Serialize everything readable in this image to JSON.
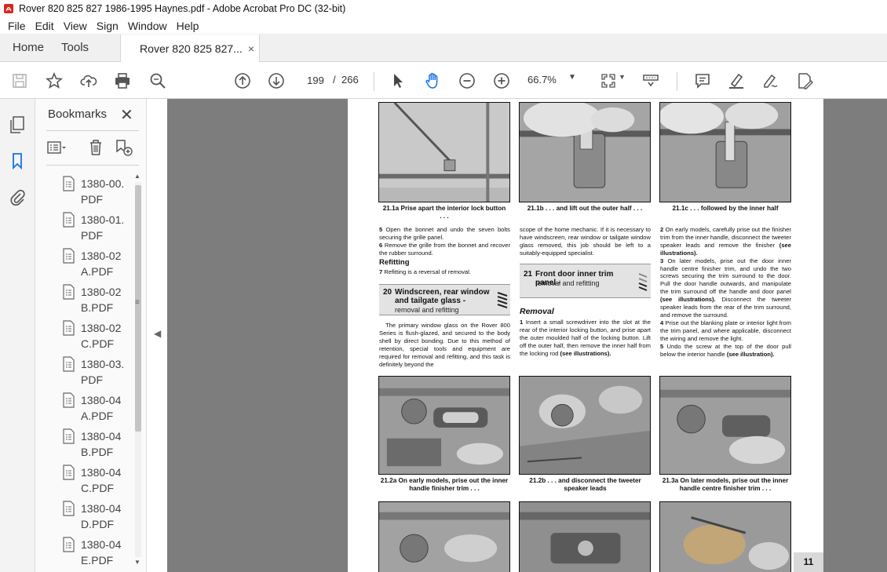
{
  "window": {
    "title": "Rover 820 825 827 1986-1995 Haynes.pdf - Adobe Acrobat Pro DC (32-bit)"
  },
  "menu": [
    "File",
    "Edit",
    "View",
    "Sign",
    "Window",
    "Help"
  ],
  "tabs": {
    "home": "Home",
    "tools": "Tools",
    "document": "Rover 820 825 827...",
    "close": "×"
  },
  "toolbar": {
    "page_current": "199",
    "page_separator": "/",
    "page_total": "266",
    "zoom": "66.7%",
    "icons": [
      "save-icon",
      "star-icon",
      "upload-icon",
      "print-icon",
      "zoom-search-icon",
      "prev-page-icon",
      "next-page-icon",
      "pointer-icon",
      "hand-icon",
      "zoom-out-icon",
      "zoom-in-icon",
      "page-fit-icon",
      "scroll-mode-icon",
      "comment-icon",
      "highlight-icon",
      "sign-icon",
      "edit-pdf-icon"
    ]
  },
  "bookmarks": {
    "title": "Bookmarks",
    "close": "✕",
    "items": [
      "1380-00.PDF",
      "1380-01.PDF",
      "1380-02A.PDF",
      "1380-02B.PDF",
      "1380-02C.PDF",
      "1380-03.PDF",
      "1380-04A.PDF",
      "1380-04B.PDF",
      "1380-04C.PDF",
      "1380-04D.PDF",
      "1380-04E.PDF"
    ]
  },
  "document": {
    "captions": {
      "c1": "21.1a  Prise apart the interior lock button . . .",
      "c2": "21.1b  . . . and lift out the outer half . . .",
      "c3": "21.1c  . . . followed by the inner half",
      "c4": "21.2a  On early models, prise out the inner handle finisher trim . . .",
      "c5": "21.2b  . . . and disconnect the tweeter speaker leads",
      "c6": "21.3a  On later models, prise out the inner handle centre finisher trim . . ."
    },
    "col1": {
      "p5_num": "5",
      "p5": "Open the bonnet and undo the seven bolts securing the grille panel.",
      "p6_num": "6",
      "p6": "Remove the grille from the bonnet and recover the rubber surround.",
      "refitting": "Refitting",
      "p7_num": "7",
      "p7": "Refitting is a reversal of removal.",
      "section20_num": "20",
      "section20_title": "Windscreen, rear window and tailgate glass -",
      "section20_sub": "removal and refitting",
      "body": "The primary window glass on the Rover 800 Series is flush-glazed, and secured to the body shell by direct bonding. Due to this method of retention, special tools and equipment are required for removal and refitting, and this task is definitely beyond the"
    },
    "col2": {
      "top": "scope of the home mechanic. If it is necessary to have windscreen, rear window or tailgate window glass removed, this job should be left to a suitably-equipped specialist.",
      "section21_num": "21",
      "section21_title": "Front door inner trim panel -",
      "section21_sub": "removal and refitting",
      "removal": "Removal",
      "p1_num": "1",
      "p1": "Insert a small screwdriver into the slot at the rear of the interior locking button, and prise apart the outer moulded half of the locking button. Lift off the outer half, then remove the inner half from the locking rod",
      "p1_ref": "(see illustrations)."
    },
    "col3": {
      "p2_num": "2",
      "p2": "On early models, carefully prise out the finisher trim from the inner handle, disconnect the tweeter speaker leads and remove the finisher",
      "p2_ref": "(see illustrations).",
      "p3_num": "3",
      "p3": "On later models, prise out the door inner handle centre finisher trim, and undo the two screws securing the trim surround to the door. Pull the door handle outwards, and manipulate the trim surround off the handle and door panel",
      "p3_ref": "(see illustrations).",
      "p3b": "Disconnect the tweeter speaker leads from the rear of the trim surround, and remove the surround.",
      "p4_num": "4",
      "p4": "Prise out the blanking plate or interior light from the trim panel, and where applicable, disconnect the wiring and remove the light.",
      "p5_num": "5",
      "p5": "Undo the screw at the top of the door pull below the interior handle",
      "p5_ref": "(see illustration)."
    },
    "page_number": "11"
  }
}
